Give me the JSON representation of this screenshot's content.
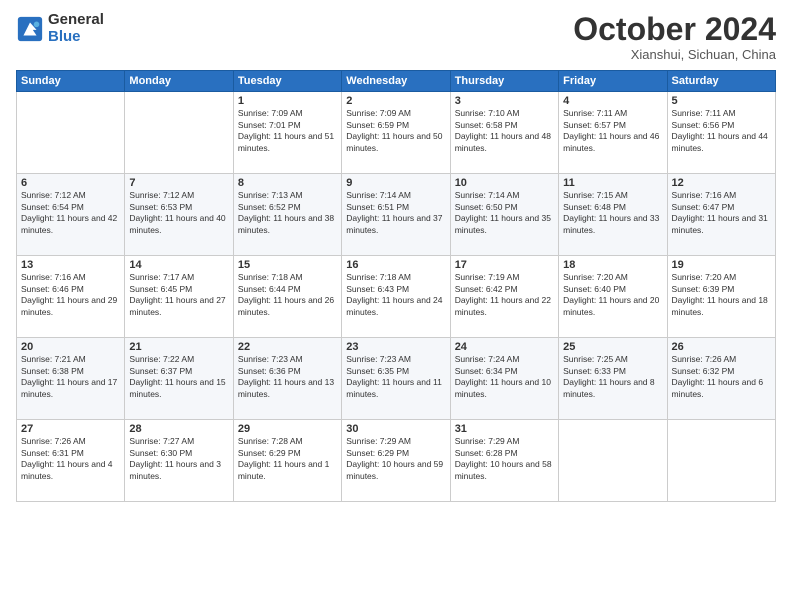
{
  "header": {
    "logo_general": "General",
    "logo_blue": "Blue",
    "month_title": "October 2024",
    "subtitle": "Xianshui, Sichuan, China"
  },
  "days_header": [
    "Sunday",
    "Monday",
    "Tuesday",
    "Wednesday",
    "Thursday",
    "Friday",
    "Saturday"
  ],
  "weeks": [
    [
      {
        "day": "",
        "content": ""
      },
      {
        "day": "",
        "content": ""
      },
      {
        "day": "1",
        "sunrise": "7:09 AM",
        "sunset": "7:01 PM",
        "daylight": "11 hours and 51 minutes."
      },
      {
        "day": "2",
        "sunrise": "7:09 AM",
        "sunset": "6:59 PM",
        "daylight": "11 hours and 50 minutes."
      },
      {
        "day": "3",
        "sunrise": "7:10 AM",
        "sunset": "6:58 PM",
        "daylight": "11 hours and 48 minutes."
      },
      {
        "day": "4",
        "sunrise": "7:11 AM",
        "sunset": "6:57 PM",
        "daylight": "11 hours and 46 minutes."
      },
      {
        "day": "5",
        "sunrise": "7:11 AM",
        "sunset": "6:56 PM",
        "daylight": "11 hours and 44 minutes."
      }
    ],
    [
      {
        "day": "6",
        "sunrise": "7:12 AM",
        "sunset": "6:54 PM",
        "daylight": "11 hours and 42 minutes."
      },
      {
        "day": "7",
        "sunrise": "7:12 AM",
        "sunset": "6:53 PM",
        "daylight": "11 hours and 40 minutes."
      },
      {
        "day": "8",
        "sunrise": "7:13 AM",
        "sunset": "6:52 PM",
        "daylight": "11 hours and 38 minutes."
      },
      {
        "day": "9",
        "sunrise": "7:14 AM",
        "sunset": "6:51 PM",
        "daylight": "11 hours and 37 minutes."
      },
      {
        "day": "10",
        "sunrise": "7:14 AM",
        "sunset": "6:50 PM",
        "daylight": "11 hours and 35 minutes."
      },
      {
        "day": "11",
        "sunrise": "7:15 AM",
        "sunset": "6:48 PM",
        "daylight": "11 hours and 33 minutes."
      },
      {
        "day": "12",
        "sunrise": "7:16 AM",
        "sunset": "6:47 PM",
        "daylight": "11 hours and 31 minutes."
      }
    ],
    [
      {
        "day": "13",
        "sunrise": "7:16 AM",
        "sunset": "6:46 PM",
        "daylight": "11 hours and 29 minutes."
      },
      {
        "day": "14",
        "sunrise": "7:17 AM",
        "sunset": "6:45 PM",
        "daylight": "11 hours and 27 minutes."
      },
      {
        "day": "15",
        "sunrise": "7:18 AM",
        "sunset": "6:44 PM",
        "daylight": "11 hours and 26 minutes."
      },
      {
        "day": "16",
        "sunrise": "7:18 AM",
        "sunset": "6:43 PM",
        "daylight": "11 hours and 24 minutes."
      },
      {
        "day": "17",
        "sunrise": "7:19 AM",
        "sunset": "6:42 PM",
        "daylight": "11 hours and 22 minutes."
      },
      {
        "day": "18",
        "sunrise": "7:20 AM",
        "sunset": "6:40 PM",
        "daylight": "11 hours and 20 minutes."
      },
      {
        "day": "19",
        "sunrise": "7:20 AM",
        "sunset": "6:39 PM",
        "daylight": "11 hours and 18 minutes."
      }
    ],
    [
      {
        "day": "20",
        "sunrise": "7:21 AM",
        "sunset": "6:38 PM",
        "daylight": "11 hours and 17 minutes."
      },
      {
        "day": "21",
        "sunrise": "7:22 AM",
        "sunset": "6:37 PM",
        "daylight": "11 hours and 15 minutes."
      },
      {
        "day": "22",
        "sunrise": "7:23 AM",
        "sunset": "6:36 PM",
        "daylight": "11 hours and 13 minutes."
      },
      {
        "day": "23",
        "sunrise": "7:23 AM",
        "sunset": "6:35 PM",
        "daylight": "11 hours and 11 minutes."
      },
      {
        "day": "24",
        "sunrise": "7:24 AM",
        "sunset": "6:34 PM",
        "daylight": "11 hours and 10 minutes."
      },
      {
        "day": "25",
        "sunrise": "7:25 AM",
        "sunset": "6:33 PM",
        "daylight": "11 hours and 8 minutes."
      },
      {
        "day": "26",
        "sunrise": "7:26 AM",
        "sunset": "6:32 PM",
        "daylight": "11 hours and 6 minutes."
      }
    ],
    [
      {
        "day": "27",
        "sunrise": "7:26 AM",
        "sunset": "6:31 PM",
        "daylight": "11 hours and 4 minutes."
      },
      {
        "day": "28",
        "sunrise": "7:27 AM",
        "sunset": "6:30 PM",
        "daylight": "11 hours and 3 minutes."
      },
      {
        "day": "29",
        "sunrise": "7:28 AM",
        "sunset": "6:29 PM",
        "daylight": "11 hours and 1 minute."
      },
      {
        "day": "30",
        "sunrise": "7:29 AM",
        "sunset": "6:29 PM",
        "daylight": "10 hours and 59 minutes."
      },
      {
        "day": "31",
        "sunrise": "7:29 AM",
        "sunset": "6:28 PM",
        "daylight": "10 hours and 58 minutes."
      },
      {
        "day": "",
        "content": ""
      },
      {
        "day": "",
        "content": ""
      }
    ]
  ]
}
